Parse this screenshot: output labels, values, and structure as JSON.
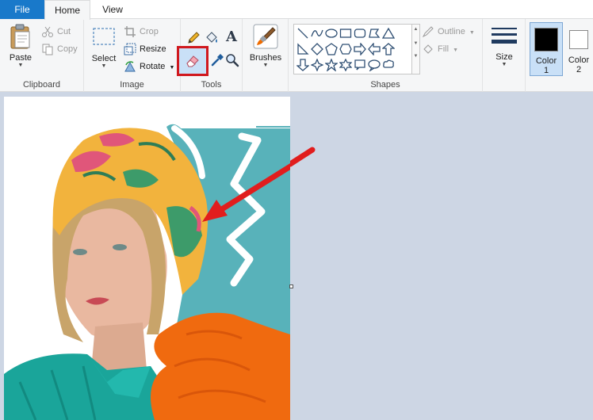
{
  "tabs": {
    "file": "File",
    "home": "Home",
    "view": "View"
  },
  "clipboard": {
    "paste": "Paste",
    "cut": "Cut",
    "copy": "Copy",
    "label": "Clipboard"
  },
  "image": {
    "select": "Select",
    "crop": "Crop",
    "resize": "Resize",
    "rotate": "Rotate",
    "label": "Image"
  },
  "tools": {
    "label": "Tools",
    "text_glyph": "A",
    "active_tool": "eraser"
  },
  "brushes": {
    "label": "Brushes"
  },
  "shapes": {
    "label": "Shapes",
    "outline": "Outline",
    "fill": "Fill"
  },
  "size": {
    "label": "Size"
  },
  "colors": {
    "color1": {
      "label_line1": "Color",
      "label_line2": "1",
      "value": "#000000"
    },
    "color2": {
      "label_line1": "Color",
      "label_line2": "2",
      "value": "#ffffff"
    }
  },
  "accent": {
    "file_tab": "#1979ca",
    "highlight": "#d0181e",
    "arrow": "#e11d1d",
    "selected_color_bg": "#c9e0f7"
  }
}
